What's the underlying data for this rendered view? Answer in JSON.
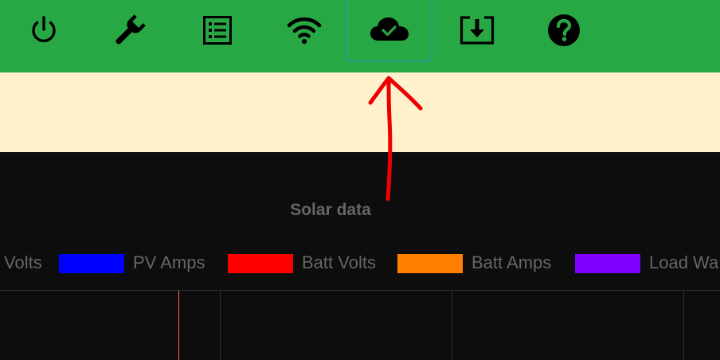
{
  "toolbar": {
    "buttons": [
      {
        "icon": "power-icon"
      },
      {
        "icon": "wrench-icon"
      },
      {
        "icon": "list-icon"
      },
      {
        "icon": "wifi-icon"
      },
      {
        "icon": "cloud-check-icon",
        "active": true
      },
      {
        "icon": "download-icon"
      },
      {
        "icon": "help-icon"
      }
    ],
    "background": "#28a745",
    "active_border": "#22a291"
  },
  "banner": {
    "background": "#fef1cc"
  },
  "chart": {
    "title": "Solar data",
    "legend": [
      {
        "label": "Volts",
        "color": null
      },
      {
        "label": "PV Amps",
        "color": "#0000ff"
      },
      {
        "label": "Batt Volts",
        "color": "#ff0000"
      },
      {
        "label": "Batt Amps",
        "color": "#ff8000"
      },
      {
        "label": "Load Wa",
        "color": "#8000ff"
      }
    ]
  },
  "annotation": {
    "arrow_color": "#ee0000"
  }
}
